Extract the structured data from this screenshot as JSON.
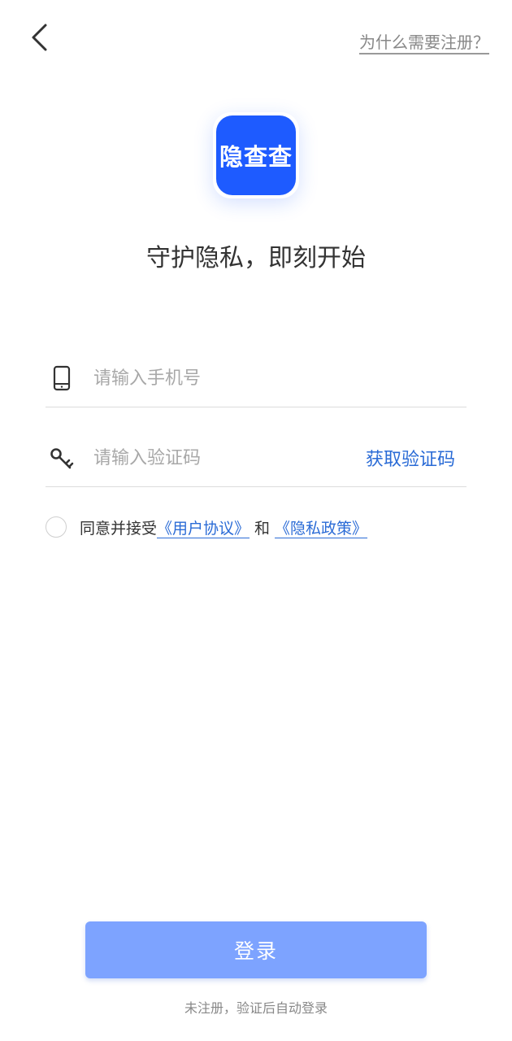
{
  "header": {
    "back_icon": "chevron-left-icon",
    "why_register_link": "为什么需要注册？"
  },
  "logo": {
    "text": "隐查查",
    "color": "#1e5bff"
  },
  "tagline": "守护隐私，即刻开始",
  "phone_field": {
    "icon": "phone-icon",
    "placeholder": "请输入手机号",
    "value": ""
  },
  "code_field": {
    "icon": "key-icon",
    "placeholder": "请输入验证码",
    "value": "",
    "get_code_label": "获取验证码"
  },
  "agreement": {
    "prefix": "同意并接受",
    "user_agreement": "《用户协议》",
    "and": "和",
    "privacy_policy": "《隐私政策》",
    "checked": false
  },
  "login_button": {
    "label": "登录",
    "color": "#7da3ff"
  },
  "footnote": "未注册，验证后自动登录"
}
